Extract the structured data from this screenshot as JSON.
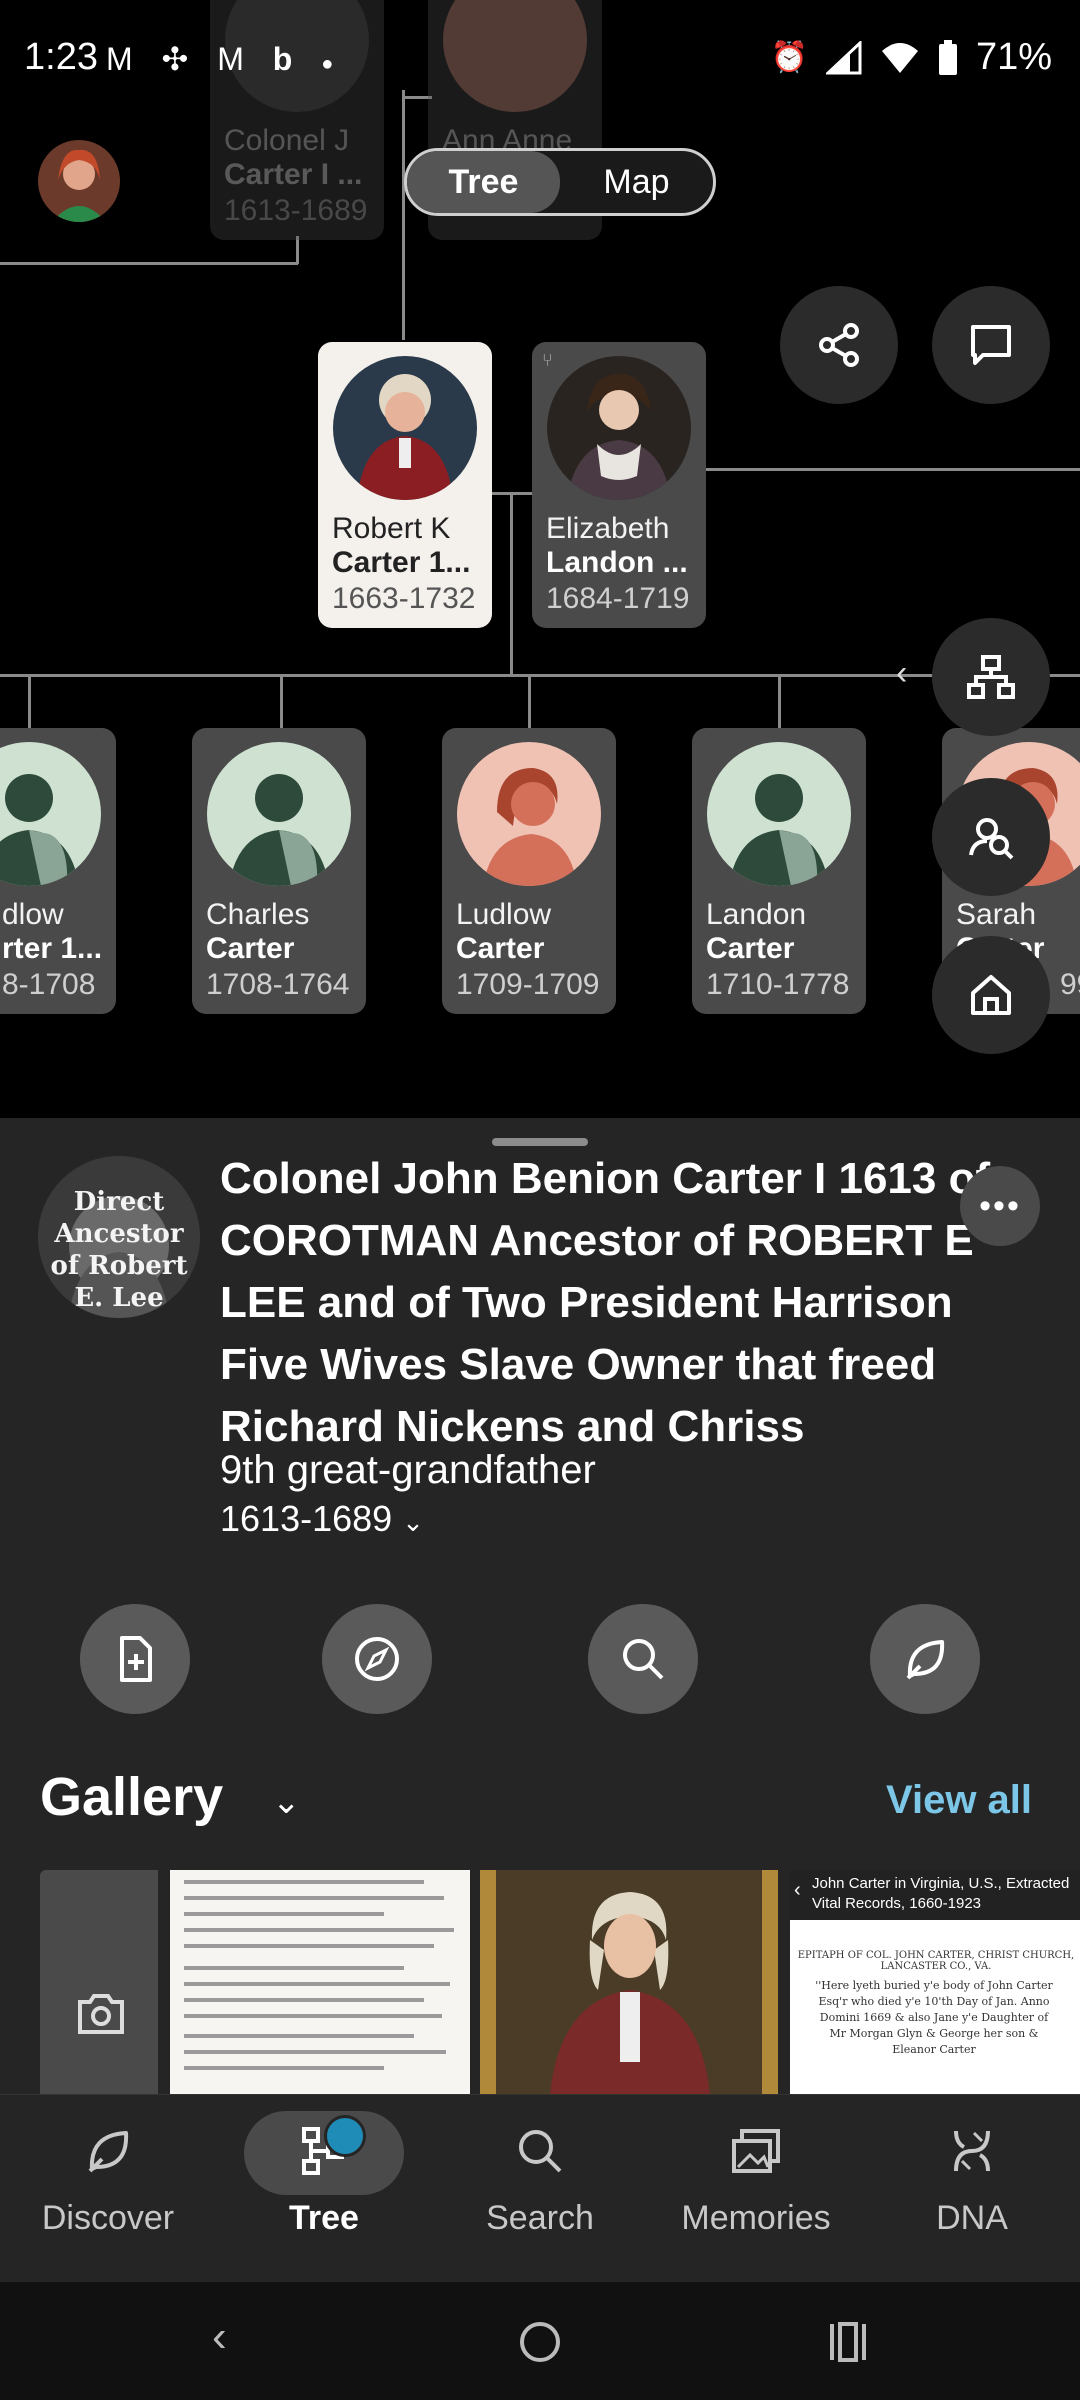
{
  "status_bar": {
    "time": "1:23",
    "left_icons": [
      "gmail-icon",
      "slack-icon",
      "gmail-icon",
      "bing-icon",
      "dot-icon"
    ],
    "battery": "71%",
    "right_icons": [
      "alarm-icon",
      "signal-icon",
      "wifi-icon",
      "battery-icon"
    ]
  },
  "view_toggle": {
    "tree_label": "Tree",
    "map_label": "Map",
    "selected": "Tree"
  },
  "tree": {
    "parents": [
      {
        "first": "Colonel J",
        "last": "Carter I ...",
        "years": "1613-1689"
      },
      {
        "first": "Ann Anne",
        "last": "",
        "years": ""
      }
    ],
    "focus": [
      {
        "first": "Robert K",
        "last": "Carter 1...",
        "years": "1663-1732",
        "selected": true
      },
      {
        "first": "Elizabeth",
        "last": "Landon ...",
        "years": "1684-1719",
        "selected": false
      }
    ],
    "children": [
      {
        "first": "dlow",
        "last": "rter 1...",
        "years": "8-1708",
        "gender": "male"
      },
      {
        "first": "Charles",
        "last": "Carter",
        "years": "1708-1764",
        "gender": "male"
      },
      {
        "first": "Ludlow",
        "last": "Carter",
        "years": "1709-1709",
        "gender": "female"
      },
      {
        "first": "Landon",
        "last": "Carter",
        "years": "1710-1778",
        "gender": "male"
      },
      {
        "first": "Sarah",
        "last": "Carter",
        "years": "99",
        "gender": "female"
      }
    ]
  },
  "profile": {
    "badge_text": "Direct Ancestor of Robert E. Lee",
    "title": "Colonel John Benion Carter I 1613 of COROTMAN Ancestor of ROBERT E LEE and of Two President Harrison Five Wives Slave Owner that freed Richard Nickens and Chriss",
    "relationship": "9th great-grandfather",
    "years": "1613-1689"
  },
  "gallery": {
    "title": "Gallery",
    "view_all": "View all",
    "record_heading": "John Carter in Virginia, U.S., Extracted Vital Records, 1660-1923",
    "record_caption": "EPITAPH OF COL. JOHN CARTER, CHRIST CHURCH, LANCASTER CO., VA.",
    "record_text": "''Here lyeth buried y'e body of John Carter Esq'r who died y'e 10'th Day of Jan. Anno Domini 1669 & also Jane y'e Daughter of Mr Morgan Glyn & George her son & Eleanor Carter"
  },
  "bottom_nav": {
    "items": [
      {
        "label": "Discover",
        "icon": "leaf-icon"
      },
      {
        "label": "Tree",
        "icon": "tree-icon",
        "active": true
      },
      {
        "label": "Search",
        "icon": "search-icon"
      },
      {
        "label": "Memories",
        "icon": "photos-icon"
      },
      {
        "label": "DNA",
        "icon": "dna-icon"
      }
    ]
  },
  "colors": {
    "accent": "#7cc6e8",
    "badge": "#1f8cb7",
    "card": "#4a4a4a",
    "selected_card": "#f4f0ec",
    "sheet": "#252525"
  }
}
